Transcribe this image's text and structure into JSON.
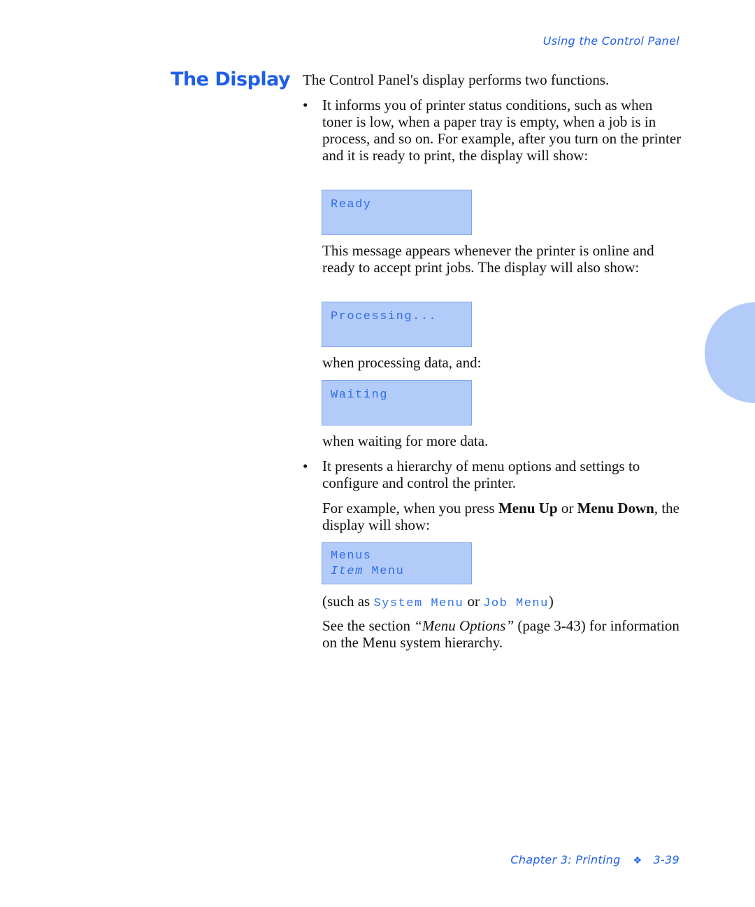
{
  "header": {
    "running_title": "Using the Control Panel"
  },
  "section": {
    "title": "The Display",
    "intro": "The Control Panel's display performs two functions.",
    "bullet_symbol": "•",
    "bullet1": {
      "text": "It informs you of printer status conditions, such as when toner is low, when a paper tray is empty, when a job is in process, and so on. For example, after you turn on the printer and it is ready to print, the display will show:",
      "lcd_ready": "Ready",
      "after_ready": "This message appears whenever the printer is online and ready to accept print jobs. The display will also show:",
      "lcd_processing": "Processing...",
      "after_processing": "when processing data, and:",
      "lcd_waiting": "Waiting",
      "after_waiting": "when waiting for more data."
    },
    "bullet2": {
      "text": "It presents a hierarchy of menu options and settings to configure and control the printer.",
      "example_prefix": "For example, when you press ",
      "key1": "Menu Up",
      "example_or": " or ",
      "key2": "Menu Down",
      "example_suffix": ", the display will show:",
      "lcd_line1": "Menus",
      "lcd_line2_italic": "Item",
      "lcd_line2_rest": " Menu",
      "such_as_prefix": "(such as ",
      "such_as_item1": "System Menu",
      "such_as_or": " or ",
      "such_as_item2": "Job Menu",
      "such_as_suffix": ")",
      "see_prefix": "See the section ",
      "see_link": "“Menu Options”",
      "see_suffix": " (page 3-43) for information on the Menu system hierarchy."
    }
  },
  "footer": {
    "chapter": "Chapter 3: Printing",
    "separator_icon": "❖",
    "page_number": "3-39"
  },
  "colors": {
    "accent": "#1f5fe8",
    "lcd_background": "#b2cbf8",
    "lcd_text": "#2f6fea"
  }
}
